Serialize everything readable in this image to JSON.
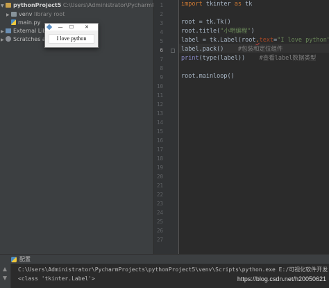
{
  "project_tree": {
    "root_name": "pythonProject5",
    "root_path": "C:\\Users\\Administrator\\PycharmProjects\\py",
    "venv_name": "venv",
    "venv_note": "library root",
    "file_main": "main.py",
    "external": "External Librar",
    "scratches": "Scratches and"
  },
  "editor": {
    "line_numbers": [
      "1",
      "2",
      "3",
      "4",
      "5",
      "6",
      "7",
      "8",
      "9",
      "10",
      "11",
      "12",
      "13",
      "14",
      "15",
      "16",
      "17",
      "18",
      "19",
      "20",
      "21",
      "22",
      "23",
      "24",
      "25",
      "26",
      "27"
    ],
    "current_line": "6",
    "lines": {
      "l1_kw": "import",
      "l1_rest": " tkinter ",
      "l1_kw2": "as",
      "l1_rest2": " tk",
      "l3": "root = tk.Tk()",
      "l4_pre": "root.title(",
      "l4_str": "\"小明编程\"",
      "l4_post": ")",
      "l5_pre": "label = tk.Label(root",
      "l5_comma": ",",
      "l5_param": "text",
      "l5_eq": "=",
      "l5_str": "\"I love python\"",
      "l5_post": ")",
      "l6_code": "label.pack()",
      "l6_comment": "#包装和定位组件",
      "l7_pre": "print",
      "l7_mid": "(type(label))",
      "l7_comment": "#查看label数据类型",
      "l9": "root.mainloop()"
    }
  },
  "tk_window": {
    "minimize": "—",
    "maximize": "☐",
    "close": "✕",
    "label_text": "I love python"
  },
  "run_panel": {
    "title": "配置",
    "out_line1": "C:\\Users\\Administrator\\PycharmProjects\\pythonProject5\\venv\\Scripts\\python.exe E:/可视化软件开发",
    "out_line2": "<class 'tkinter.Label'>",
    "watermark": "https://blog.csdn.net/h20050621"
  }
}
